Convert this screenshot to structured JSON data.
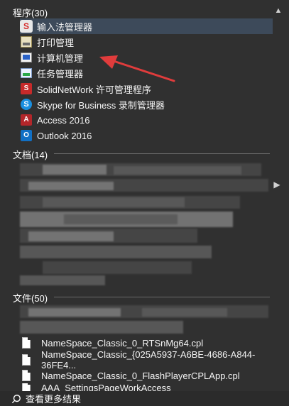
{
  "sections": {
    "programs": {
      "title": "程序(30)"
    },
    "documents": {
      "title": "文档(14)"
    },
    "files": {
      "title": "文件(50)"
    }
  },
  "programs": [
    {
      "label": "输入法管理器",
      "icon": "ime-icon"
    },
    {
      "label": "打印管理",
      "icon": "printer-icon"
    },
    {
      "label": "计算机管理",
      "icon": "computer-management-icon"
    },
    {
      "label": "任务管理器",
      "icon": "task-manager-icon"
    },
    {
      "label": "SolidNetWork 许可管理程序",
      "icon": "solidnetwork-icon"
    },
    {
      "label": "Skype for Business 录制管理器",
      "icon": "skype-icon"
    },
    {
      "label": "Access 2016",
      "icon": "access-icon"
    },
    {
      "label": "Outlook 2016",
      "icon": "outlook-icon"
    }
  ],
  "files": [
    {
      "label": "NameSpace_Classic_0_RTSnMg64.cpl"
    },
    {
      "label": "NameSpace_Classic_{025A5937-A6BE-4686-A844-36FE4..."
    },
    {
      "label": "NameSpace_Classic_0_FlashPlayerCPLApp.cpl"
    },
    {
      "label": "AAA_SettingsPageWorkAccess"
    }
  ],
  "footer": {
    "label": "查看更多结果"
  },
  "colors": {
    "background": "#303030",
    "highlight": "#3d4a5a",
    "annotation_arrow": "#e03c3c"
  }
}
